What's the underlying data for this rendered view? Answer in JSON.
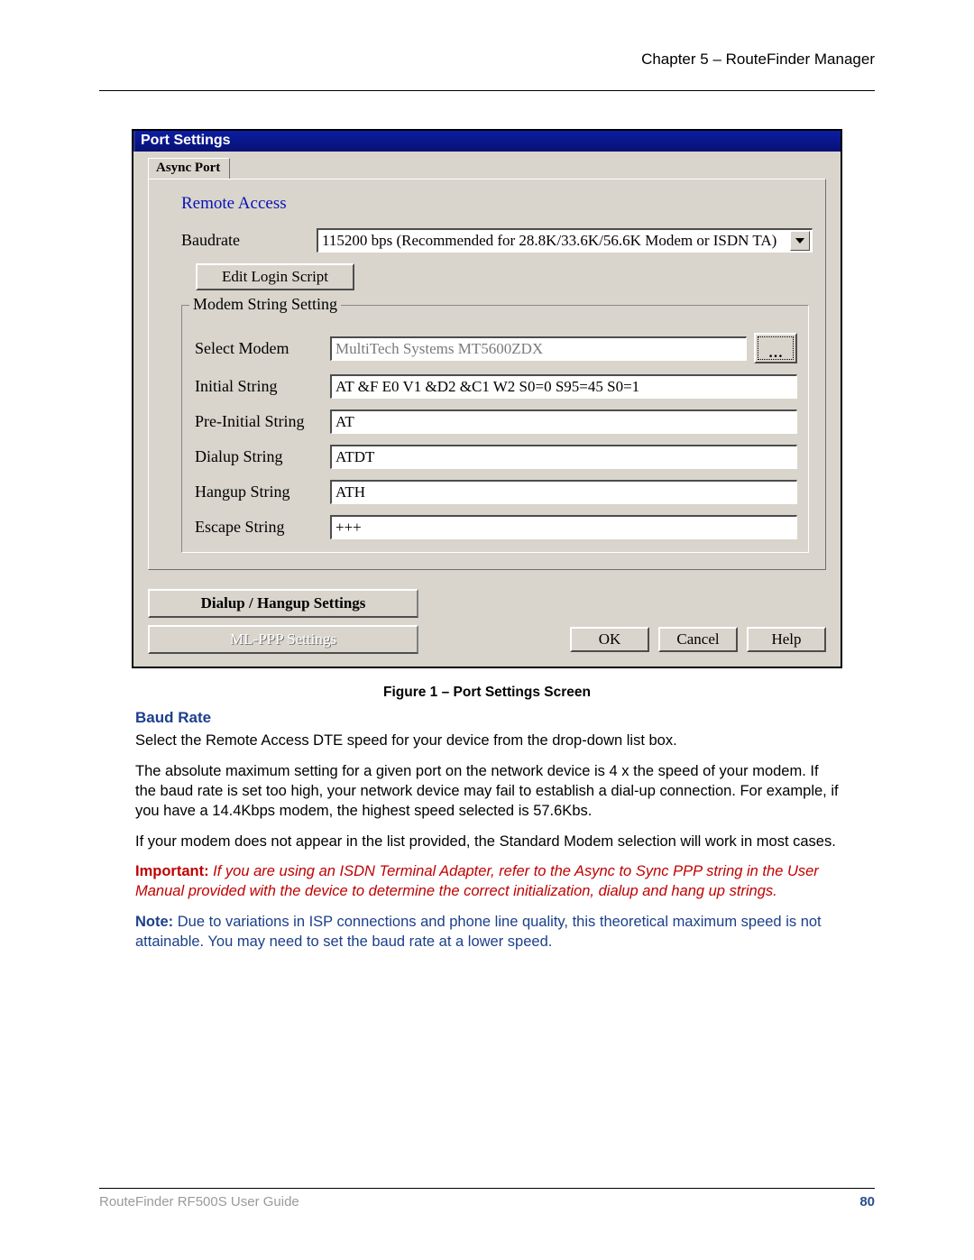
{
  "header": {
    "chapter": "Chapter 5 – RouteFinder Manager"
  },
  "footer": {
    "guide": "RouteFinder RF500S User Guide",
    "page": "80"
  },
  "dialog": {
    "title": "Port Settings",
    "tab": "Async Port",
    "section": "Remote Access",
    "baudrate_label": "Baudrate",
    "baudrate_value": "115200 bps (Recommended for 28.8K/33.6K/56.6K Modem or ISDN TA)",
    "edit_login": "Edit Login Script",
    "modem_group": "Modem String Setting",
    "select_modem_label": "Select Modem",
    "select_modem_value": "MultiTech Systems MT5600ZDX",
    "initial_label": "Initial String",
    "initial_value": "AT &F E0 V1 &D2 &C1 W2 S0=0 S95=45 S0=1",
    "preinitial_label": "Pre-Initial String",
    "preinitial_value": "AT",
    "dialup_label": "Dialup String",
    "dialup_value": "ATDT",
    "hangup_label": "Hangup String",
    "hangup_value": "ATH",
    "escape_label": "Escape String",
    "escape_value": "+++",
    "dialup_hangup_btn": "Dialup / Hangup Settings",
    "mlppp_btn": "ML-PPP Settings",
    "ok": "OK",
    "cancel": "Cancel",
    "help": "Help"
  },
  "caption": "Figure 1 – Port Settings Screen",
  "doc": {
    "h_baud": "Baud Rate",
    "p1": "Select the Remote Access DTE speed for your device from the drop-down list box.",
    "p2": "The absolute maximum setting for a given port on the network device is 4 x the speed of your modem.  If the baud rate is set too high, your network device may fail to establish a dial-up connection. For example, if you have a 14.4Kbps modem, the highest speed selected is 57.6Kbs.",
    "p3": "If your modem does not appear in the list provided, the Standard Modem selection will work in most cases.",
    "imp_label": "Important:",
    "imp_text": "  If you are using an ISDN Terminal Adapter, refer to the Async to Sync PPP string in the User Manual provided with the device to determine the correct initialization, dialup and hang up strings.",
    "note_label": "Note:",
    "note_text": "  Due to variations in ISP connections and phone line quality, this theoretical maximum speed is not attainable. You may need to set the baud rate at a lower speed."
  }
}
